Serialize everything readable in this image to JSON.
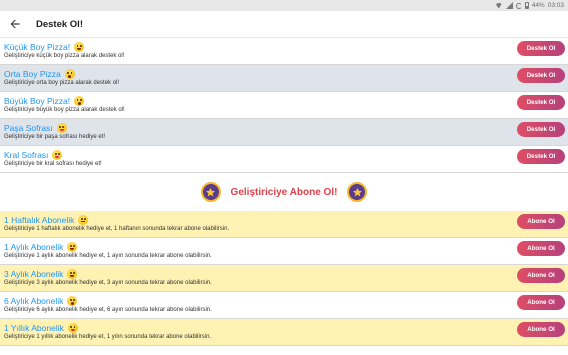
{
  "status_bar": {
    "battery": "44%",
    "time": "03:03"
  },
  "app_bar": {
    "title": "Destek Ol!"
  },
  "donations": [
    {
      "title": "Küçük Boy Pizza!",
      "emoji": "grinning-sweat-emoji",
      "description": "Geliştiriciye küçük boy pizza alarak destek ol!",
      "button": "Destek Ol"
    },
    {
      "title": "Orta Boy Pizza",
      "emoji": "astonished-emoji",
      "description": "Geliştiriciye orta boy pizza alarak destek ol!",
      "button": "Destek Ol"
    },
    {
      "title": "Büyük Boy Pizza!",
      "emoji": "astonished-emoji",
      "description": "Geliştiriciye büyük boy pizza alarak destek ol!",
      "button": "Destek Ol"
    },
    {
      "title": "Paşa Sofrası",
      "emoji": "tongue-out-emoji",
      "description": "Geliştiriciye bir paşa sofrası hediye et!",
      "button": "Destek Ol"
    },
    {
      "title": "Kral Sofrası",
      "emoji": "tongue-out-emoji",
      "description": "Geliştiriciye bir kral sofrası hediye et!",
      "button": "Destek Ol"
    }
  ],
  "subscription_section": {
    "title": "Geliştiriciye Abone Ol!"
  },
  "subscriptions": [
    {
      "title": "1 Haftalık Abonelik",
      "emoji": "neutral-emoji",
      "description": "Geliştiriciye 1 haftalık abonelik hediye et, 1 haftanın sonunda tekrar abone olabilirsin.",
      "button": "Abone Ol"
    },
    {
      "title": "1 Aylık Abonelik",
      "emoji": "grinning-sweat-emoji",
      "description": "Geliştiriciye 1 aylık abonelik hediye et, 1 ayın sonunda tekrar abone olabilirsin.",
      "button": "Abone Ol"
    },
    {
      "title": "3 Aylık Abonelik",
      "emoji": "grinning-sweat-emoji",
      "description": "Geliştiriciye 3 aylık abonelik hediye et, 3 ayın sonunda tekrar abone olabilirsin.",
      "button": "Abone Ol"
    },
    {
      "title": "6 Aylık Abonelik",
      "emoji": "astonished-emoji",
      "description": "Geliştiriciye 6 aylık abonelik hediye et, 6 ayın sonunda tekrar abone olabilirsin.",
      "button": "Abone Ol"
    },
    {
      "title": "1 Yıllık Abonelik",
      "emoji": "tongue-out-emoji",
      "description": "Geliştiriciye 1 yıllık abonelik hediye et, 1 yılın sonunda tekrar abone olabilirsin.",
      "button": "Abone Ol"
    }
  ],
  "colors": {
    "title_blue": "#2196f3",
    "section_red": "#e0404a",
    "button_gradient_start": "#de4e64",
    "button_gradient_end": "#b6417c",
    "row_gray": "#dfe4ea",
    "row_yellow": "#fff2b3",
    "badge_purple": "#5b3b8c",
    "badge_gold": "#f5b92e"
  }
}
